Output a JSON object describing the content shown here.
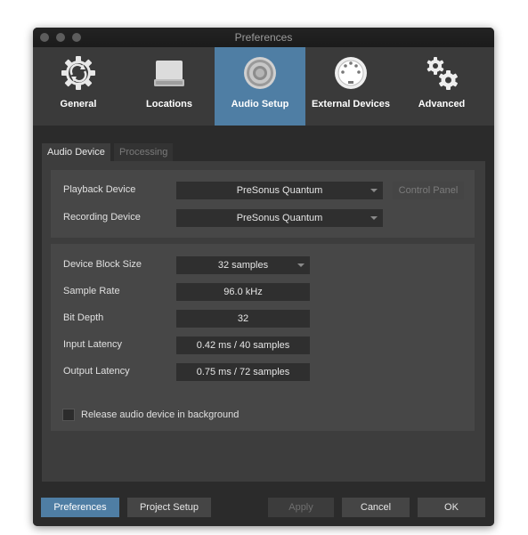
{
  "window": {
    "title": "Preferences"
  },
  "toolbar": {
    "items": [
      {
        "label": "General",
        "icon": "general-icon"
      },
      {
        "label": "Locations",
        "icon": "drive-icon"
      },
      {
        "label": "Audio Setup",
        "icon": "speaker-icon",
        "active": true
      },
      {
        "label": "External Devices",
        "icon": "midi-connector-icon"
      },
      {
        "label": "Advanced",
        "icon": "gears-icon"
      }
    ]
  },
  "tabs": {
    "audio_device": "Audio Device",
    "processing": "Processing"
  },
  "devices": {
    "playback_label": "Playback Device",
    "playback_value": "PreSonus Quantum",
    "recording_label": "Recording Device",
    "recording_value": "PreSonus Quantum",
    "control_panel": "Control Panel"
  },
  "settings": {
    "block_size_label": "Device Block Size",
    "block_size_value": "32 samples",
    "sample_rate_label": "Sample Rate",
    "sample_rate_value": "96.0 kHz",
    "bit_depth_label": "Bit Depth",
    "bit_depth_value": "32",
    "input_latency_label": "Input Latency",
    "input_latency_value": "0.42 ms / 40 samples",
    "output_latency_label": "Output Latency",
    "output_latency_value": "0.75 ms / 72 samples",
    "release_label": "Release audio device in background",
    "release_checked": false
  },
  "footer": {
    "preferences": "Preferences",
    "project_setup": "Project Setup",
    "apply": "Apply",
    "cancel": "Cancel",
    "ok": "OK"
  },
  "colors": {
    "accent": "#4f7ea4",
    "background": "#2b2b2b",
    "toolbar": "#3a3a3a"
  }
}
